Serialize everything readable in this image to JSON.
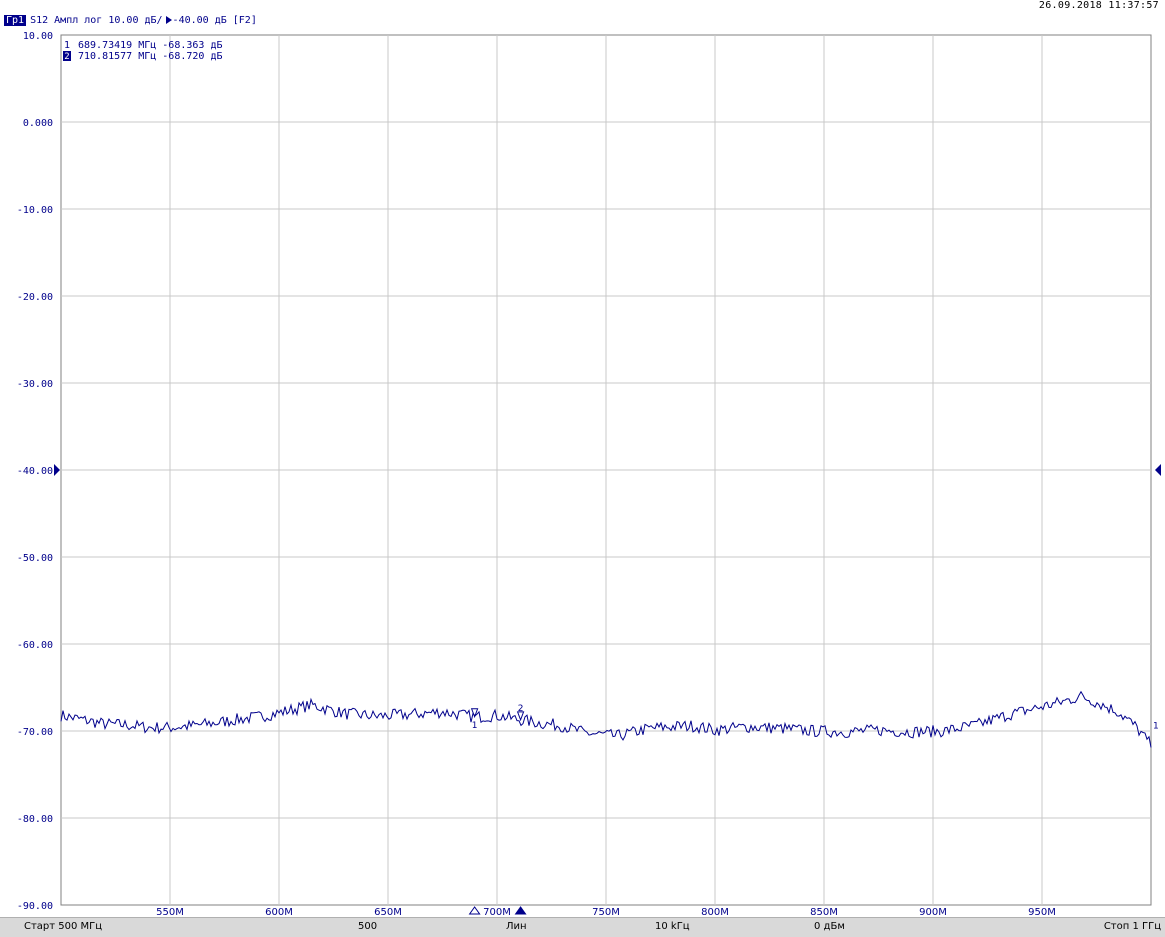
{
  "timestamp": "26.09.2018 11:37:57",
  "trace": {
    "badge": "Гр1",
    "param": "S12",
    "format": "Ампл лог",
    "scale": "10.00 дБ/",
    "ref_value": "-40.00 дБ",
    "tag": "[F2]"
  },
  "markers": [
    {
      "num": "1",
      "active": false,
      "readout": "689.73419 МГц -68.363 дБ",
      "x": 689.73419,
      "y": -68.363
    },
    {
      "num": "2",
      "active": true,
      "readout": "710.81577 МГц -68.720 дБ",
      "x": 710.81577,
      "y": -68.72
    }
  ],
  "trace_end_label": "1",
  "status_bar": {
    "start": "Старт  500 МГц",
    "points": "500",
    "sweep_type": "Лин",
    "ifbw": "10 kГц",
    "power": "0 дБм",
    "stop": "Стоп  1 ГГц"
  },
  "colors": {
    "trace": "#00008b",
    "grid": "#c8c8c8",
    "text": "#00008b",
    "status_bg": "#d9d9d9"
  },
  "chart_data": {
    "type": "line",
    "title": "",
    "xlabel": "",
    "ylabel": "",
    "xlim": [
      500,
      1000
    ],
    "ylim": [
      -90,
      10
    ],
    "reference_level": -40,
    "grid": true,
    "y_ticks": [
      "10.00",
      "0.000",
      "-10.00",
      "-20.00",
      "-30.00",
      "-40.00",
      "-50.00",
      "-60.00",
      "-70.00",
      "-80.00",
      "-90.00"
    ],
    "y_tick_values": [
      10,
      0,
      -10,
      -20,
      -30,
      -40,
      -50,
      -60,
      -70,
      -80,
      -90
    ],
    "x_ticks": [
      "550M",
      "600M",
      "650M",
      "700M",
      "750M",
      "800M",
      "850M",
      "900M",
      "950M"
    ],
    "x_tick_values": [
      550,
      600,
      650,
      700,
      750,
      800,
      850,
      900,
      950
    ],
    "series": [
      {
        "x": [
          500,
          510,
          520,
          530,
          540,
          550,
          560,
          570,
          580,
          590,
          600,
          615,
          630,
          645,
          660,
          675,
          690,
          700,
          710,
          720,
          730,
          740,
          755,
          770,
          780,
          790,
          800,
          815,
          830,
          845,
          860,
          875,
          890,
          905,
          920,
          935,
          950,
          960,
          968,
          975,
          985,
          993,
          1000
        ],
        "y": [
          -68.2,
          -68.7,
          -69.2,
          -69.3,
          -69.6,
          -69.6,
          -69.4,
          -69.1,
          -68.7,
          -68.4,
          -67.9,
          -67.0,
          -68.0,
          -68.3,
          -68.1,
          -67.8,
          -68.4,
          -68.2,
          -68.7,
          -69.1,
          -69.4,
          -70.2,
          -70.6,
          -69.7,
          -69.5,
          -69.4,
          -69.9,
          -69.5,
          -69.7,
          -70.0,
          -70.1,
          -69.9,
          -70.1,
          -70.0,
          -69.3,
          -68.1,
          -67.2,
          -66.6,
          -66.0,
          -66.7,
          -67.8,
          -69.5,
          -71.6
        ]
      }
    ]
  }
}
